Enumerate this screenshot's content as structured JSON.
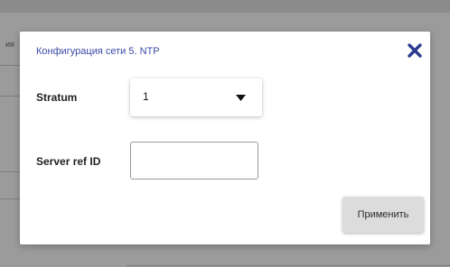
{
  "background": {
    "fragment_text": "ия"
  },
  "dialog": {
    "title": "Конфигурация сети 5. NTP",
    "close_icon": "close-x-icon",
    "stratum": {
      "label": "Stratum",
      "selected_value": "1",
      "caret_icon": "caret-down-icon"
    },
    "server_ref_id": {
      "label": "Server ref ID",
      "value": "",
      "placeholder": ""
    },
    "apply_label": "Применить"
  },
  "colors": {
    "title": "#3b4aa8",
    "close_icon": "#2b3a8f",
    "overlay": "#8c8c8c",
    "apply_button_bg": "#dcdcdc"
  }
}
